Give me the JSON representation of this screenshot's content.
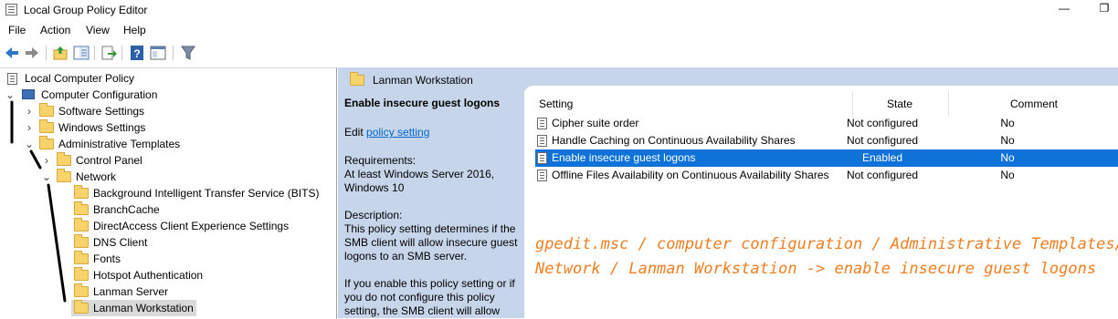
{
  "window": {
    "title": "Local Group Policy Editor",
    "minimize_glyph": "—",
    "restore_glyph": "❐"
  },
  "menu": [
    "File",
    "Action",
    "View",
    "Help"
  ],
  "toolbar": {
    "icons": [
      "back-arrow-icon",
      "forward-arrow-icon",
      "up-folder-icon",
      "show-hide-tree-icon",
      "export-list-icon",
      "help-icon",
      "properties-icon",
      "filter-icon"
    ]
  },
  "tree": {
    "root": "Local Computer Policy",
    "computer_configuration": "Computer Configuration",
    "software_settings": "Software Settings",
    "windows_settings": "Windows Settings",
    "administrative_templates": "Administrative Templates",
    "control_panel": "Control Panel",
    "network": "Network",
    "network_children": [
      "Background Intelligent Transfer Service (BITS)",
      "BranchCache",
      "DirectAccess Client Experience Settings",
      "DNS Client",
      "Fonts",
      "Hotspot Authentication",
      "Lanman Server",
      "Lanman Workstation"
    ]
  },
  "right": {
    "header": "Lanman Workstation",
    "description": {
      "title": "Enable insecure guest logons",
      "edit_prefix": "Edit ",
      "edit_link": "policy setting ",
      "requirements_label": "Requirements:",
      "requirements_text": "At least Windows Server 2016, Windows 10",
      "description_label": "Description:",
      "description_text": "This policy setting determines if the SMB client will allow insecure guest logons to an SMB server.",
      "description_text2": "If you enable this policy setting or if you do not configure this policy setting, the SMB client will allow"
    },
    "columns": [
      "Setting",
      "State",
      "Comment"
    ],
    "rows": [
      {
        "name": "Cipher suite order",
        "state": "Not configured",
        "comment": "No"
      },
      {
        "name": "Handle Caching on Continuous Availability Shares",
        "state": "Not configured",
        "comment": "No"
      },
      {
        "name": "Enable insecure guest logons",
        "state": "Enabled",
        "comment": "No"
      },
      {
        "name": "Offline Files Availability on Continuous Availability Shares",
        "state": "Not configured",
        "comment": "No"
      }
    ]
  },
  "annotation": {
    "line1": "gpedit.msc / computer configuration / Administrative Templates/",
    "line2": "Network  / Lanman Workstation -> enable insecure guest logons"
  },
  "colors": {
    "selection": "#0f72d8",
    "panel": "#c7d5ea",
    "annotation": "#f07e22"
  }
}
